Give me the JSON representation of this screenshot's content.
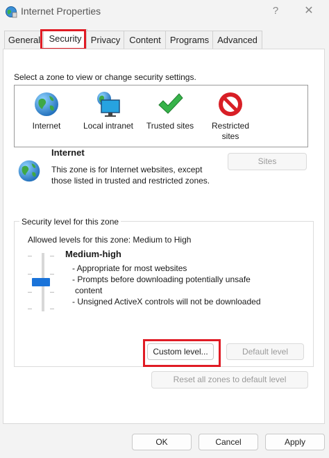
{
  "window": {
    "title": "Internet Properties",
    "help_glyph": "?",
    "close_glyph": "✕"
  },
  "tabs": [
    {
      "label": "General"
    },
    {
      "label": "Security"
    },
    {
      "label": "Privacy"
    },
    {
      "label": "Content"
    },
    {
      "label": "Programs"
    },
    {
      "label": "Advanced"
    }
  ],
  "zone_prompt": "Select a zone to view or change security settings.",
  "zones": [
    {
      "label": "Internet",
      "icon": "globe-icon"
    },
    {
      "label": "Local intranet",
      "icon": "intranet-globe-monitor-icon"
    },
    {
      "label": "Trusted sites",
      "icon": "green-checkmark-icon"
    },
    {
      "label": "Restricted sites",
      "icon": "red-no-entry-icon"
    }
  ],
  "selected_zone": {
    "title": "Internet",
    "description": "This zone is for Internet websites, except those listed in trusted and restricted zones."
  },
  "sites_button": "Sites",
  "security_level": {
    "group_label": "Security level for this zone",
    "allowed": "Allowed levels for this zone: Medium to High",
    "level_name": "Medium-high",
    "bullets": [
      "- Appropriate for most websites",
      "- Prompts before downloading potentially unsafe",
      "content",
      "- Unsigned ActiveX controls will not be downloaded"
    ]
  },
  "buttons": {
    "custom_level": "Custom level...",
    "default_level": "Default level",
    "reset_all": "Reset all zones to default level",
    "ok": "OK",
    "cancel": "Cancel",
    "apply": "Apply"
  },
  "colors": {
    "highlight": "#e01b24",
    "slider_thumb": "#1a73d9"
  }
}
